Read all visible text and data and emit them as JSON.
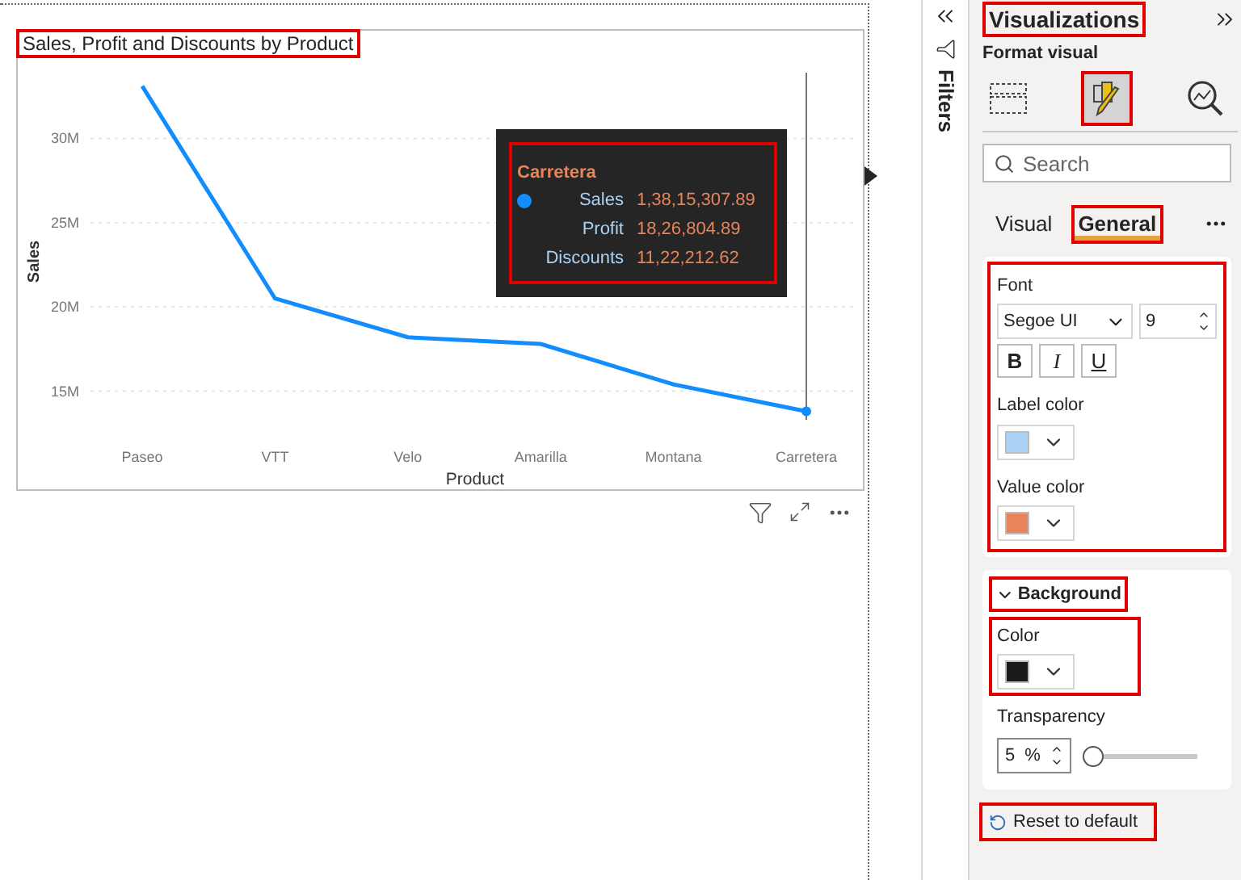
{
  "visual": {
    "title": "Sales, Profit and Discounts by Product",
    "chart_data": {
      "type": "line",
      "xlabel": "Product",
      "ylabel": "Sales",
      "categories": [
        "Paseo",
        "VTT",
        "Velo",
        "Amarilla",
        "Montana",
        "Carretera"
      ],
      "series": [
        {
          "name": "Sales",
          "color": "#118dff",
          "values": [
            33.1,
            20.5,
            18.2,
            17.8,
            15.4,
            13.8
          ]
        }
      ],
      "grid": true,
      "ref_lines": [
        {
          "axis": "x",
          "value": "Carretera",
          "color": "#777777"
        }
      ],
      "ylim": [
        13.3,
        33.9
      ],
      "yticks": [
        {
          "value": 15,
          "label": "15M"
        },
        {
          "value": 20,
          "label": "20M"
        },
        {
          "value": 25,
          "label": "25M"
        },
        {
          "value": 30,
          "label": "30M"
        }
      ]
    },
    "tooltip": {
      "title": "Carretera",
      "rows": [
        {
          "kind": "series",
          "value": "1,38,15,307.89",
          "color": "#118dff"
        },
        {
          "kind": "measure",
          "label": "Profit",
          "value": "18,26,804.89"
        },
        {
          "kind": "measure",
          "label": "Discounts",
          "value": "11,22,212.62"
        }
      ]
    }
  },
  "filters_pane": {
    "label": "Filters"
  },
  "visualizations_pane": {
    "title": "Visualizations",
    "subtitle": "Format visual",
    "view_tabs": [
      {
        "kind": "fields",
        "selected": false
      },
      {
        "kind": "format",
        "selected": true
      },
      {
        "kind": "analytics",
        "selected": false
      }
    ],
    "search": {
      "placeholder": "Search"
    },
    "tabs": [
      {
        "label": "Visual",
        "selected": false
      },
      {
        "label": "General",
        "selected": true
      }
    ],
    "font": {
      "label": "Font",
      "family": "Segoe UI",
      "size": "9",
      "styles": [
        "B",
        "I",
        "U"
      ]
    },
    "label_color": {
      "label": "Label color",
      "color": "#a9d2f5"
    },
    "value_color": {
      "label": "Value color",
      "color": "#e8845a"
    },
    "background": {
      "title": "Background",
      "expanded": true,
      "color_label": "Color",
      "color": "#1a1a1a",
      "transparency_label": "Transparency",
      "transparency": "5",
      "unit": "%",
      "level": 0.02
    },
    "reset": "Reset to default"
  }
}
